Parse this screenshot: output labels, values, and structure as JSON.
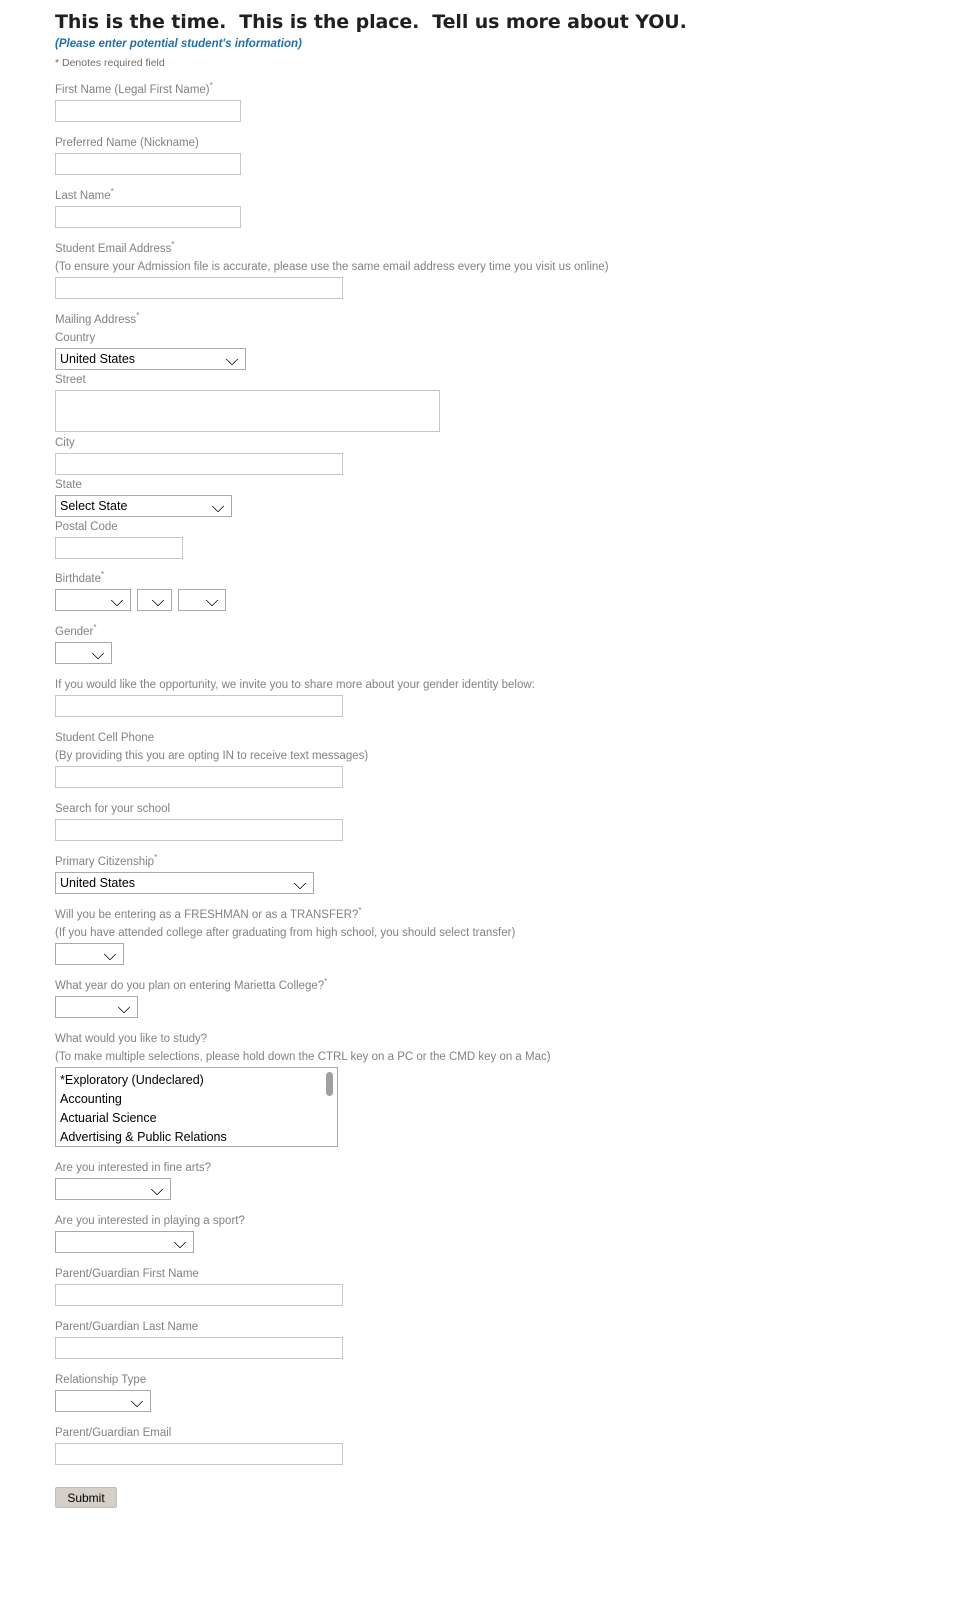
{
  "header": {
    "title": "This is the time.  This is the place.  Tell us more about YOU.",
    "subtitle": "(Please enter potential student's information)",
    "required_note": "* Denotes required field",
    "subtitle_color": "#1f6fb4",
    "title_color": "#231f20"
  },
  "fields": {
    "first_name": {
      "label": "First Name (Legal First Name)",
      "required": true,
      "value": "",
      "type": "text"
    },
    "preferred_name": {
      "label": "Preferred Name (Nickname)",
      "required": false,
      "value": "",
      "type": "text"
    },
    "last_name": {
      "label": "Last Name",
      "required": true,
      "value": "",
      "type": "text"
    },
    "student_email": {
      "label": "Student Email Address",
      "required": true,
      "helper": "(To ensure your Admission file is accurate, please use the same email address every time you visit us online)",
      "value": "",
      "type": "text"
    },
    "mailing_address": {
      "label": "Mailing Address",
      "required": true
    },
    "country": {
      "label": "Country",
      "selected": "United States",
      "type": "select"
    },
    "street": {
      "label": "Street",
      "value": "",
      "type": "textarea"
    },
    "city": {
      "label": "City",
      "value": "",
      "type": "text"
    },
    "state": {
      "label": "State",
      "selected": "Select State",
      "type": "select"
    },
    "postal_code": {
      "label": "Postal Code",
      "value": "",
      "type": "text"
    },
    "birthdate": {
      "label": "Birthdate",
      "required": true,
      "month_selected": "",
      "day_selected": "",
      "year_selected": ""
    },
    "gender": {
      "label": "Gender",
      "required": true,
      "selected": "",
      "type": "select"
    },
    "gender_identity": {
      "label": "If you would like the opportunity, we invite you to share more about your gender identity below:",
      "value": "",
      "type": "text"
    },
    "student_cell_phone": {
      "label": "Student Cell Phone",
      "helper": "(By providing this you are opting IN to receive text messages)",
      "value": "",
      "type": "text"
    },
    "school_search": {
      "label": "Search for your school",
      "value": "",
      "type": "text"
    },
    "primary_citizenship": {
      "label": "Primary Citizenship",
      "required": true,
      "selected": "United States",
      "type": "select"
    },
    "entry_type": {
      "label": "Will you be entering as a FRESHMAN or as a TRANSFER?",
      "required": true,
      "helper": "(If you have attended college after graduating from high school, you should select transfer)",
      "selected": "",
      "type": "select"
    },
    "entry_year": {
      "label": "What year do you plan on entering Marietta College?",
      "required": true,
      "selected": "",
      "type": "select"
    },
    "study": {
      "label": "What would you like to study?",
      "helper": "(To make multiple selections, please hold down the CTRL key on a PC or the CMD key on a Mac)",
      "type": "multiselect",
      "options": [
        "*Exploratory (Undeclared)",
        "Accounting",
        "Actuarial Science",
        "Advertising & Public Relations"
      ]
    },
    "fine_arts": {
      "label": "Are you interested in fine arts?",
      "selected": "",
      "type": "select"
    },
    "sport": {
      "label": "Are you interested in playing a sport?",
      "selected": "",
      "type": "select"
    },
    "pg_first_name": {
      "label": "Parent/Guardian First Name",
      "value": "",
      "type": "text"
    },
    "pg_last_name": {
      "label": "Parent/Guardian Last Name",
      "value": "",
      "type": "text"
    },
    "relationship_type": {
      "label": "Relationship Type",
      "selected": "",
      "type": "select"
    },
    "pg_email": {
      "label": "Parent/Guardian Email",
      "value": "",
      "type": "text"
    }
  },
  "actions": {
    "submit_label": "Submit"
  }
}
